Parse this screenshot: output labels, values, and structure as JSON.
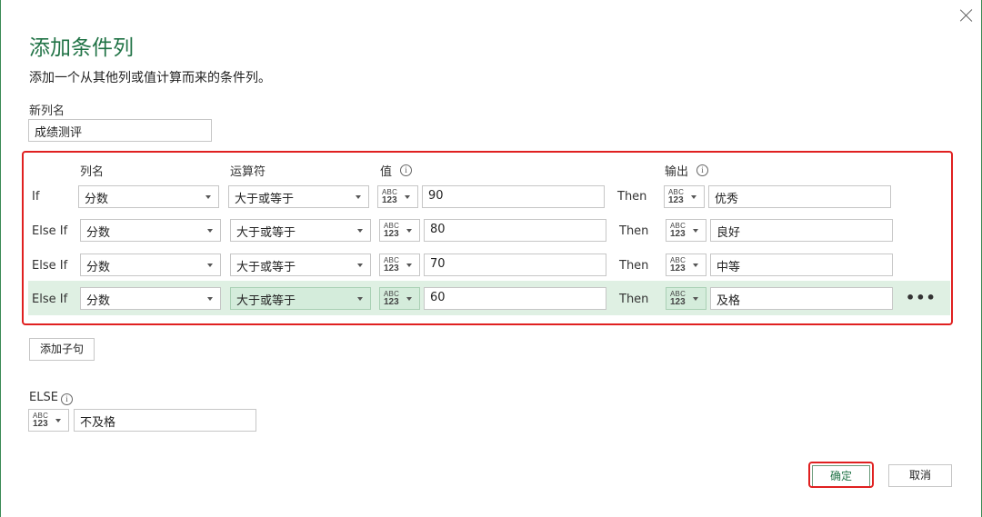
{
  "dialog": {
    "title": "添加条件列",
    "description": "添加一个从其他列或值计算而来的条件列。"
  },
  "new_column": {
    "label": "新列名",
    "value": "成绩测评"
  },
  "headers": {
    "column": "列名",
    "operator": "运算符",
    "value": "值",
    "output": "输出"
  },
  "type_icon": {
    "abc": "ABC",
    "num": "123"
  },
  "then_label": "Then",
  "clauses": [
    {
      "label": "If",
      "column": "分数",
      "operator": "大于或等于",
      "value": "90",
      "output": "优秀"
    },
    {
      "label": "Else If",
      "column": "分数",
      "operator": "大于或等于",
      "value": "80",
      "output": "良好"
    },
    {
      "label": "Else If",
      "column": "分数",
      "operator": "大于或等于",
      "value": "70",
      "output": "中等"
    },
    {
      "label": "Else If",
      "column": "分数",
      "operator": "大于或等于",
      "value": "60",
      "output": "及格"
    }
  ],
  "more_label": "•••",
  "add_clause_label": "添加子句",
  "else": {
    "label": "ELSE",
    "value": "不及格"
  },
  "buttons": {
    "ok": "确定",
    "cancel": "取消"
  },
  "colors": {
    "accent": "#217346",
    "highlight": "#e02020",
    "row_selected": "#dff0e3"
  }
}
